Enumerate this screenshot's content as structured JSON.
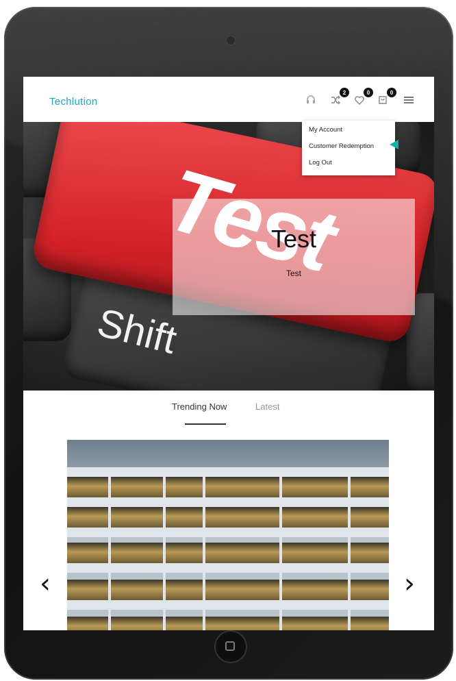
{
  "header": {
    "logo": "Techlution",
    "icons": [
      {
        "name": "headset-icon",
        "badge": ""
      },
      {
        "name": "shuffle-icon",
        "badge": "2"
      },
      {
        "name": "heart-icon",
        "badge": "0"
      },
      {
        "name": "cart-icon",
        "badge": "0"
      },
      {
        "name": "menu-icon",
        "badge": ""
      }
    ]
  },
  "dropdown": {
    "items": [
      "My Account",
      "Customer Redemption",
      "Log Out"
    ]
  },
  "hero": {
    "key_text": "Test",
    "shift_text": "Shift",
    "title": "Test",
    "subtitle": "Test"
  },
  "tabs": [
    {
      "label": "Trending Now",
      "active": true
    },
    {
      "label": "Latest",
      "active": false
    }
  ],
  "carousel": {
    "prev": "‹",
    "next": "›"
  },
  "colors": {
    "brand": "#1fa3c9",
    "cursor": "#14b3b0",
    "key_red": "#d32228"
  }
}
